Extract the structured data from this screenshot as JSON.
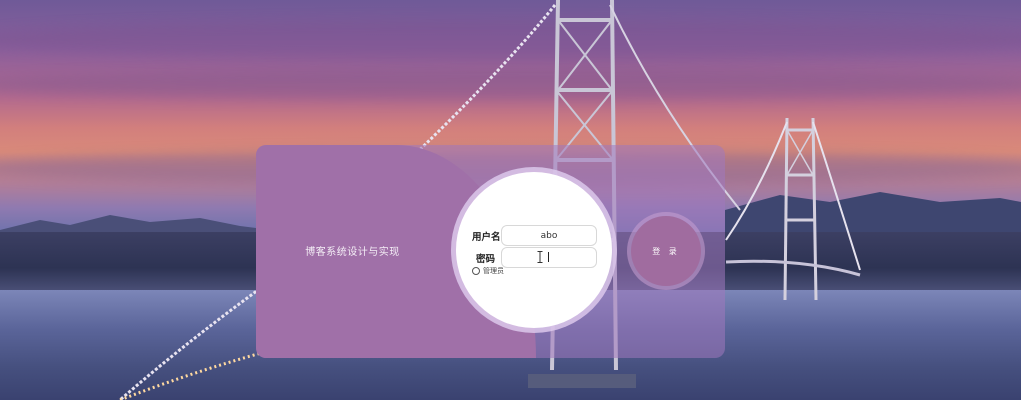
{
  "app": {
    "title": "博客系统设计与实现"
  },
  "login_form": {
    "username_label": "用户名",
    "username_value": "abo",
    "password_label": "密码",
    "password_value": "",
    "admin_option_label": "管理员",
    "submit_label": "登 录"
  },
  "colors": {
    "card_left": "#a070a8",
    "login_button": "#a06c9f",
    "form_circle": "#ffffff"
  }
}
